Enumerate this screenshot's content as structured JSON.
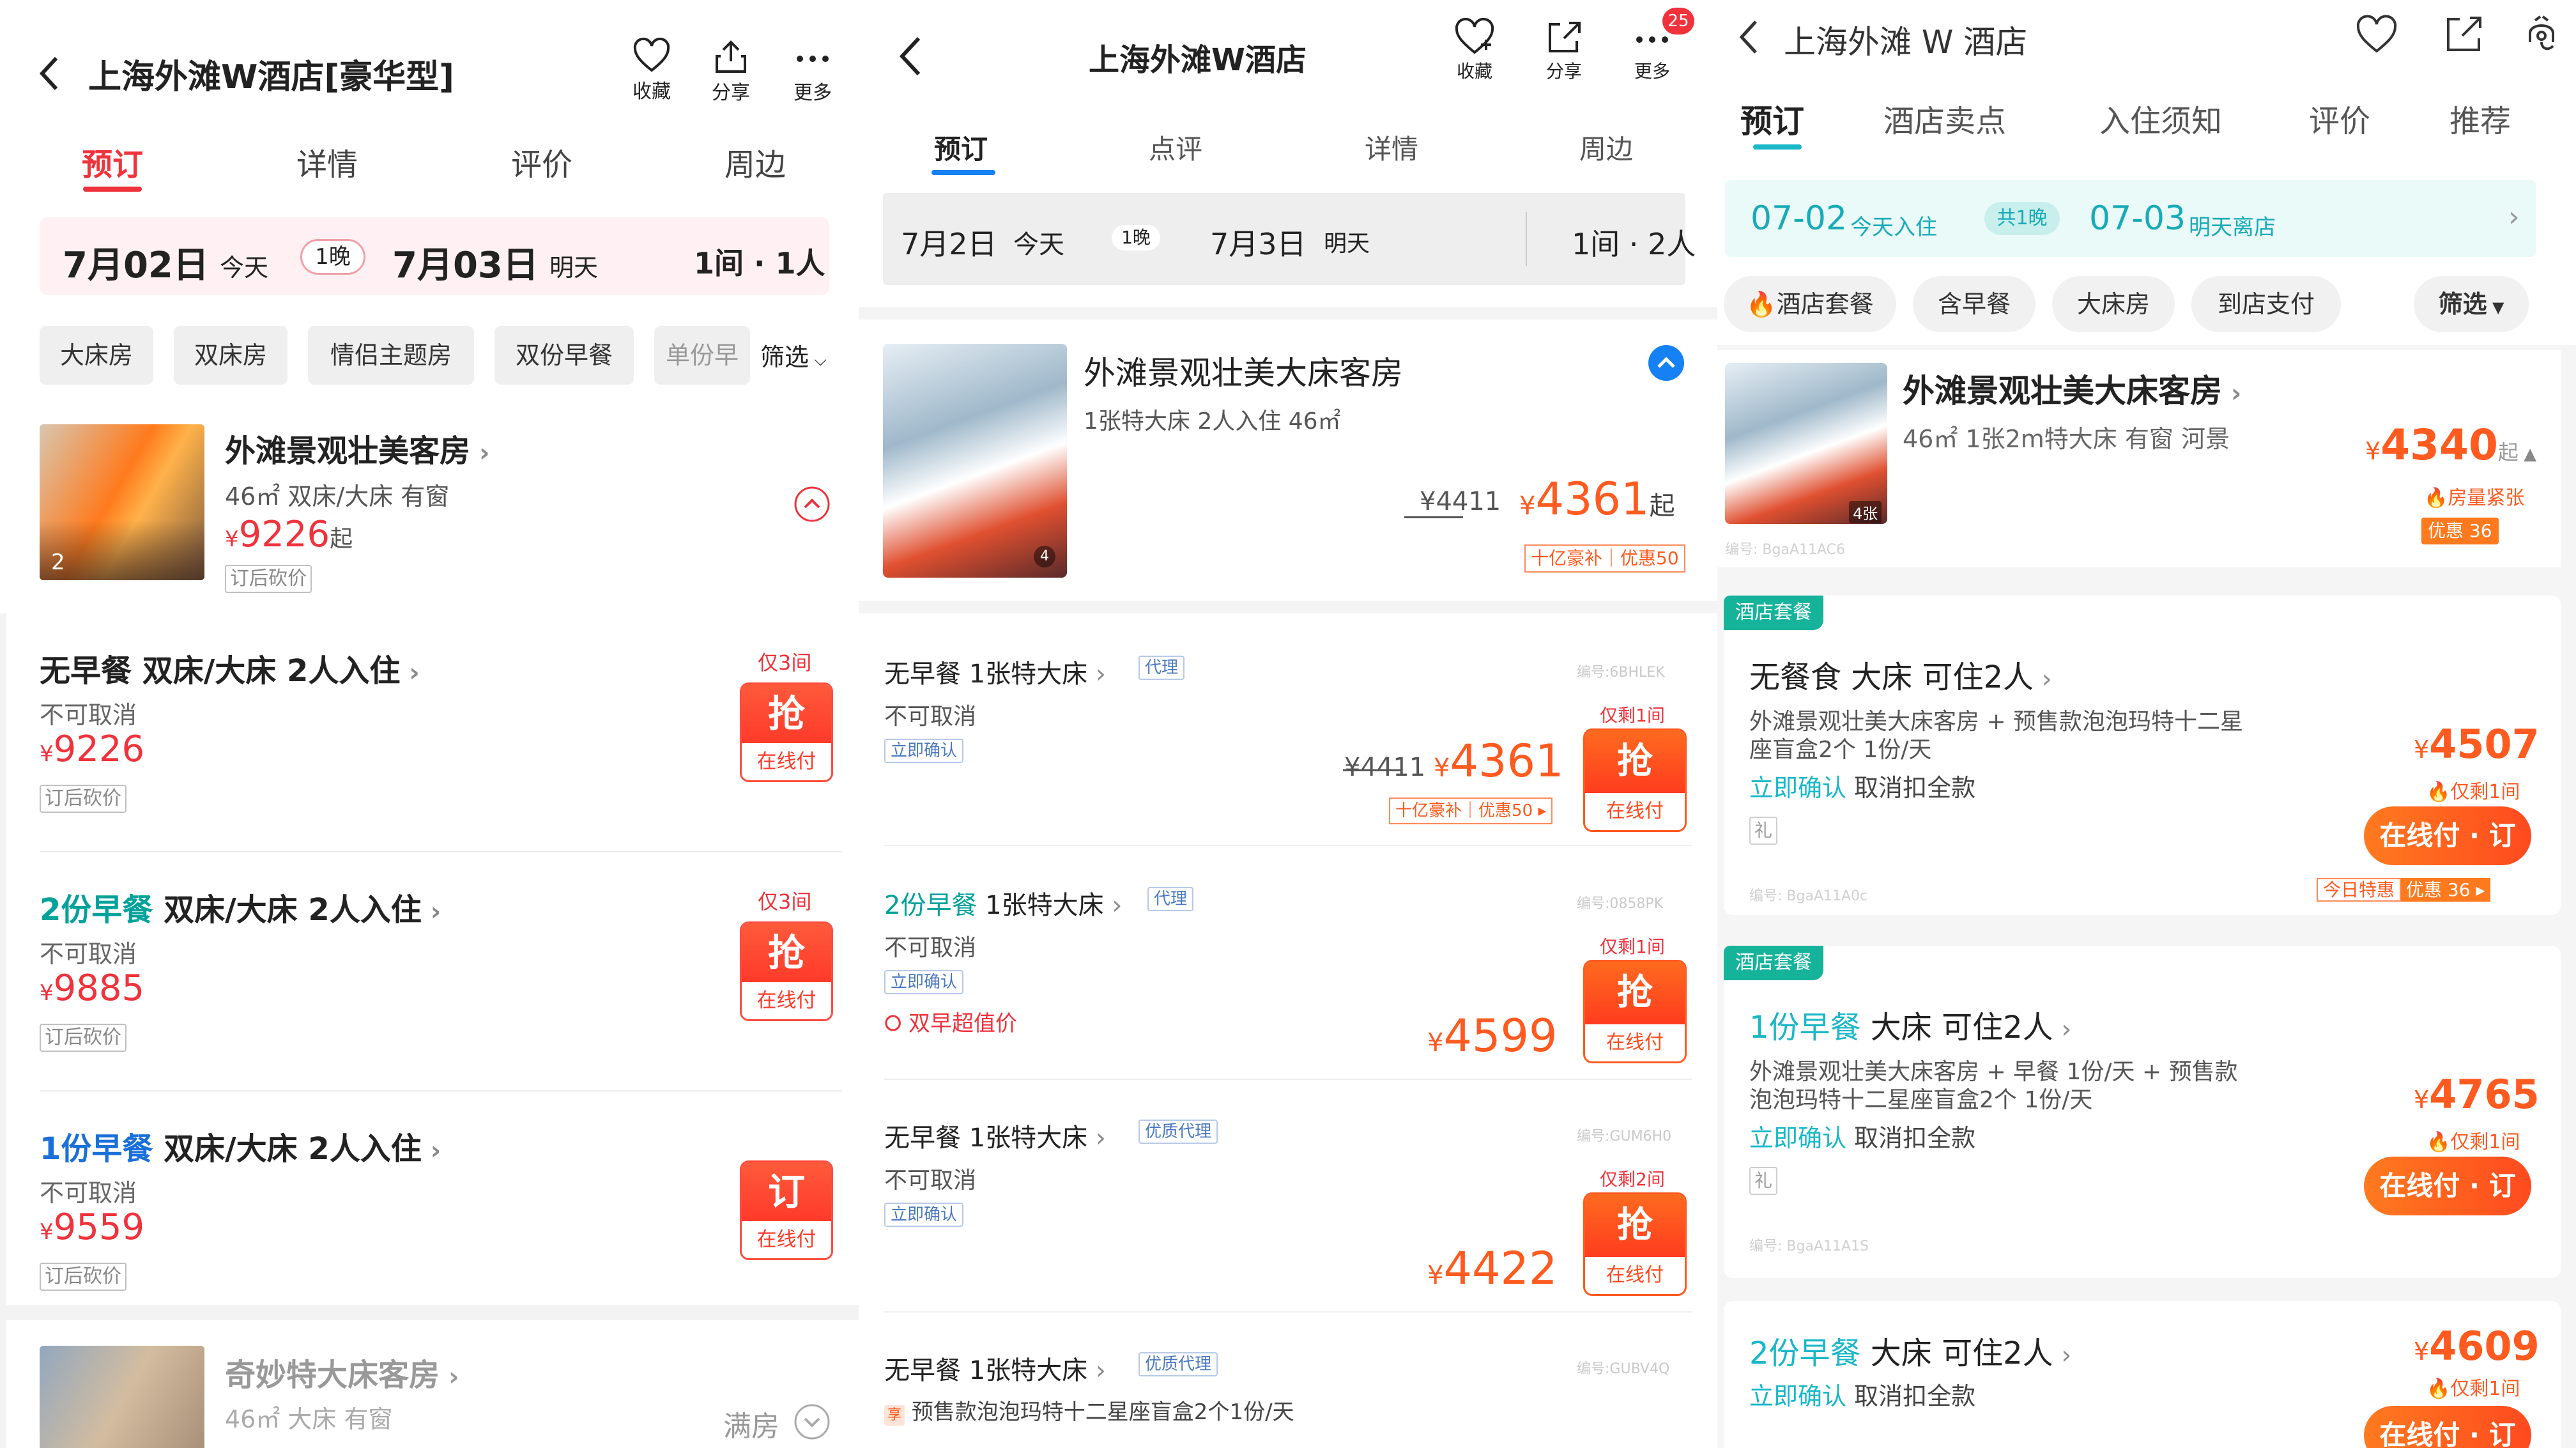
{
  "p1": {
    "title": "上海外滩W酒店[豪华型]",
    "actions": [
      "收藏",
      "分享",
      "更多"
    ],
    "tabs": [
      "预订",
      "详情",
      "评价",
      "周边"
    ],
    "date": {
      "checkin": "7月02日",
      "checkin_day": "今天",
      "nights": "1晚",
      "checkout": "7月03日",
      "checkout_day": "明天",
      "rooms": "1间 · 1人"
    },
    "filters": [
      "大床房",
      "双床房",
      "情侣主题房",
      "双份早餐",
      "单份早",
      "筛选"
    ],
    "room1": {
      "name": "外滩景观壮美客房",
      "info": "46㎡ 双床/大床 有窗",
      "price": "9226",
      "price_suffix": "起",
      "note": "订后砍价",
      "photo_count": "2"
    },
    "offers": [
      {
        "title_pre": "无早餐",
        "title": " 双床/大床 2人入住",
        "cancel": "不可取消",
        "price": "9226",
        "note": "订后砍价",
        "stock": "仅3间",
        "btn": "抢",
        "btn_sub": "在线付"
      },
      {
        "title_pre": "2份早餐",
        "title": " 双床/大床 2人入住",
        "cancel": "不可取消",
        "price": "9885",
        "note": "订后砍价",
        "stock": "仅3间",
        "btn": "抢",
        "btn_sub": "在线付"
      },
      {
        "title_pre": "1份早餐",
        "title": " 双床/大床 2人入住",
        "cancel": "不可取消",
        "price": "9559",
        "note": "订后砍价",
        "stock": "",
        "btn": "订",
        "btn_sub": "在线付"
      }
    ],
    "room2": {
      "name": "奇妙特大床客房",
      "info": "46㎡ 大床 有窗",
      "status": "满房"
    },
    "currency": "¥"
  },
  "p2": {
    "title": "上海外滩W酒店",
    "actions": [
      "收藏",
      "分享",
      "更多"
    ],
    "badge": "25",
    "tabs": [
      "预订",
      "点评",
      "详情",
      "周边"
    ],
    "date": {
      "checkin": "7月2日",
      "checkin_day": "今天",
      "nights": "1晚",
      "checkout": "7月3日",
      "checkout_day": "明天",
      "rooms": "1间 · 2人"
    },
    "room": {
      "name": "外滩景观壮美大床客房",
      "info": "1张特大床  2人入住  46㎡",
      "orig_price": "¥4411",
      "price": "4361",
      "price_suffix": "起",
      "promo_a": "十亿豪补",
      "promo_b": "优惠50",
      "photo_count": "4"
    },
    "offers": [
      {
        "title": "无早餐  1张特大床",
        "tag": "代理",
        "code": "编号:6BHLEK",
        "cancel": "不可取消",
        "confirm": "立即确认",
        "orig_price": "¥4411",
        "price": "4361",
        "promo_a": "十亿豪补",
        "promo_b": "优惠50",
        "stock": "仅剩1间",
        "btn": "抢",
        "btn_sub": "在线付"
      },
      {
        "title_pre": "2份早餐",
        "title": "  1张特大床",
        "tag": "代理",
        "code": "编号:0858PK",
        "cancel": "不可取消",
        "confirm": "立即确认",
        "special": "双早超值价",
        "price": "4599",
        "stock": "仅剩1间",
        "btn": "抢",
        "btn_sub": "在线付"
      },
      {
        "title": "无早餐  1张特大床",
        "tag": "优质代理",
        "code": "编号:GUM6H0",
        "cancel": "不可取消",
        "confirm": "立即确认",
        "price": "4422",
        "stock": "仅剩2间",
        "btn": "抢",
        "btn_sub": "在线付"
      },
      {
        "title": "无早餐  1张特大床",
        "tag": "优质代理",
        "code": "编号:GUBV4Q",
        "gift_tag": "享",
        "gift": "预售款泡泡玛特十二星座盲盒2个1份/天"
      }
    ],
    "currency": "¥"
  },
  "p3": {
    "title": "上海外滩 W 酒店",
    "tabs": [
      "预订",
      "酒店卖点",
      "入住须知",
      "评价",
      "推荐"
    ],
    "date": {
      "checkin": "07-02",
      "checkin_label": "今天入住",
      "nights": "共1晚",
      "checkout": "07-03",
      "checkout_label": "明天离店"
    },
    "chips": [
      "酒店套餐",
      "含早餐",
      "大床房",
      "到店支付",
      "筛选"
    ],
    "room": {
      "name": "外滩景观壮美大床客房",
      "info": "46㎡  1张2m特大床  有窗  河景",
      "code": "编号: BgaA11AC6",
      "price": "4340",
      "price_suffix": "起",
      "scarce": "房量紧张",
      "discount": "优惠 36",
      "photo_count": "4张"
    },
    "packages": [
      {
        "tag": "酒店套餐",
        "title": "无餐食  大床  可住2人",
        "desc1": "外滩景观壮美大床客房 + 预售款泡泡玛特十二星",
        "desc2": "座盲盒2个 1份/天",
        "confirm": "立即确认",
        "cancel": "取消扣全款",
        "gift": "礼",
        "code": "编号: BgaA11A0c",
        "price": "4507",
        "stock": "仅剩1间",
        "btn": "在线付 · 订",
        "promo_a": "今日特惠",
        "promo_b": "优惠 36"
      },
      {
        "tag": "酒店套餐",
        "title_pre": "1份早餐",
        "title": "  大床  可住2人",
        "desc1": "外滩景观壮美大床客房 + 早餐 1份/天 + 预售款",
        "desc2": "泡泡玛特十二星座盲盒2个 1份/天",
        "confirm": "立即确认",
        "cancel": "取消扣全款",
        "gift": "礼",
        "code": "编号: BgaA11A1S",
        "price": "4765",
        "stock": "仅剩1间",
        "btn": "在线付 · 订"
      },
      {
        "title_pre": "2份早餐",
        "title": "  大床  可住2人",
        "confirm": "立即确认",
        "cancel": "取消扣全款",
        "price": "4609",
        "stock": "仅剩1间",
        "btn": "在线付 · 订"
      }
    ],
    "currency": "¥"
  },
  "colors": {
    "red": "#f0323c",
    "orange": "#ff5a1f",
    "teal": "#00a29a",
    "blue": "#1680f5"
  }
}
